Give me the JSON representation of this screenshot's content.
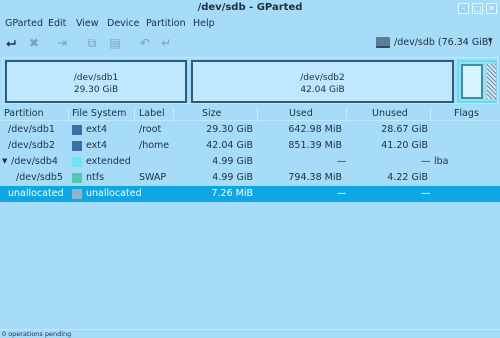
{
  "window": {
    "title": "/dev/sdb - GParted"
  },
  "menubar": {
    "items": [
      "GParted",
      "Edit",
      "View",
      "Device",
      "Partition",
      "Help"
    ]
  },
  "toolbar": {
    "buttons": [
      {
        "name": "new",
        "icon": "new-partition-icon"
      },
      {
        "name": "delete",
        "icon": "delete-icon"
      },
      {
        "name": "resize",
        "icon": "resize-move-icon"
      },
      {
        "name": "copy",
        "icon": "copy-icon"
      },
      {
        "name": "paste",
        "icon": "paste-icon"
      },
      {
        "name": "undo",
        "icon": "undo-icon"
      },
      {
        "name": "apply",
        "icon": "apply-icon"
      }
    ],
    "device_label": "/dev/sdb  (76.34 GiB)"
  },
  "partition_map": {
    "sdb1": {
      "name": "/dev/sdb1",
      "size": "29.30 GiB"
    },
    "sdb2": {
      "name": "/dev/sdb2",
      "size": "42.04 GiB"
    }
  },
  "table": {
    "columns": [
      "Partition",
      "File System",
      "Label",
      "Size",
      "Used",
      "Unused",
      "Flags"
    ],
    "rows": [
      {
        "partition": "/dev/sdb1",
        "fs": "ext4",
        "fs_color": "#3a6fa8",
        "label": "/root",
        "size": "29.30 GiB",
        "used": "642.98 MiB",
        "unused": "28.67 GiB",
        "flags": ""
      },
      {
        "partition": "/dev/sdb2",
        "fs": "ext4",
        "fs_color": "#3a6fa8",
        "label": "/home",
        "size": "42.04 GiB",
        "used": "851.39 MiB",
        "unused": "41.20 GiB",
        "flags": ""
      },
      {
        "partition": "/dev/sdb4",
        "fs": "extended",
        "fs_color": "#6fe4f5",
        "label": "",
        "size": "4.99 GiB",
        "used": "—",
        "unused": "—",
        "flags": "lba"
      },
      {
        "partition": "/dev/sdb5",
        "fs": "ntfs",
        "fs_color": "#52c8b0",
        "label": "SWAP",
        "size": "4.99 GiB",
        "used": "794.38 MiB",
        "unused": "4.22 GiB",
        "flags": ""
      },
      {
        "partition": "unallocated",
        "fs": "unallocated",
        "fs_color": "#8fb4c8",
        "label": "",
        "size": "7.26 MiB",
        "used": "—",
        "unused": "—",
        "flags": ""
      }
    ]
  },
  "status": {
    "text": "0 operations pending"
  }
}
